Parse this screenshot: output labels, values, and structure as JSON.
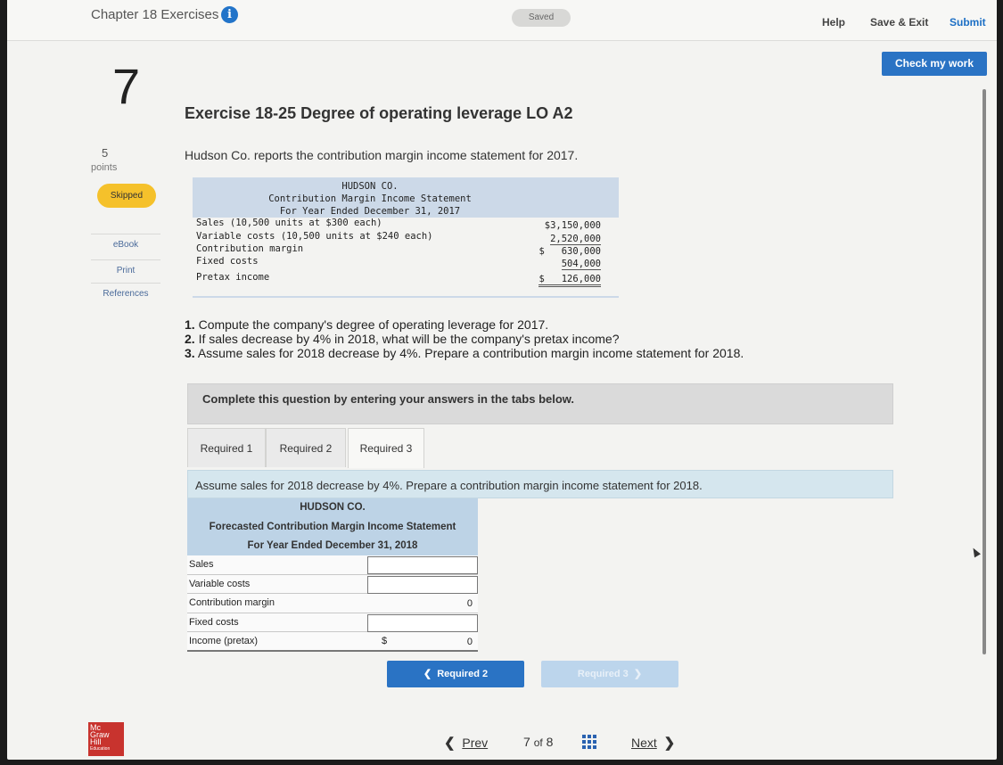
{
  "topbar": {
    "chapter_title": "Chapter 18 Exercises",
    "info_icon": "i",
    "saved_status": "Saved",
    "help": "Help",
    "save_exit": "Save & Exit",
    "submit": "Submit"
  },
  "check_my_work": "Check my work",
  "question": {
    "number": "7",
    "points_value": "5",
    "points_label": "points",
    "status_badge": "Skipped"
  },
  "sidebar": {
    "items": [
      {
        "label": "eBook"
      },
      {
        "label": "Print"
      },
      {
        "label": "References"
      }
    ]
  },
  "exercise": {
    "title": "Exercise 18-25 Degree of operating leverage LO A2",
    "intro": "Hudson Co. reports the contribution margin income statement for 2017."
  },
  "statement": {
    "company": "HUDSON CO.",
    "name": "Contribution Margin Income Statement",
    "period": "For Year Ended December 31, 2017",
    "rows": [
      {
        "label": "Sales (10,500 units at $300 each)",
        "amount": "$3,150,000"
      },
      {
        "label": "Variable costs (10,500 units at $240 each)",
        "amount": "2,520,000"
      },
      {
        "label": "Contribution margin",
        "amount": "$   630,000"
      },
      {
        "label": "Fixed costs",
        "amount": "504,000"
      },
      {
        "label": "Pretax income",
        "amount": "$   126,000"
      }
    ]
  },
  "questions": [
    {
      "num": "1.",
      "text": "Compute the company's degree of operating leverage for 2017."
    },
    {
      "num": "2.",
      "text": "If sales decrease by 4% in 2018, what will be the company's pretax income?"
    },
    {
      "num": "3.",
      "text": "Assume sales for 2018 decrease by 4%. Prepare a contribution margin income statement for 2018."
    }
  ],
  "instructions": "Complete this question by entering your answers in the tabs below.",
  "tabs": [
    {
      "label": "Required 1"
    },
    {
      "label": "Required 2"
    },
    {
      "label": "Required 3"
    }
  ],
  "prompt": "Assume sales for 2018 decrease by 4%. Prepare a contribution margin income statement for 2018.",
  "form": {
    "company": "HUDSON CO.",
    "name": "Forecasted Contribution Margin Income Statement",
    "period": "For Year Ended December 31, 2018",
    "rows": [
      {
        "label": "Sales",
        "value": ""
      },
      {
        "label": "Variable costs",
        "value": ""
      },
      {
        "label": "Contribution margin",
        "value": "0"
      },
      {
        "label": "Fixed costs",
        "value": ""
      },
      {
        "label": "Income (pretax)",
        "dollar": "$",
        "value": "0"
      }
    ]
  },
  "nav": {
    "prev_required": "Required 2",
    "next_required": "Required 3"
  },
  "logo": {
    "line1": "Mc",
    "line2": "Graw",
    "line3": "Hill",
    "line4": "Education"
  },
  "footer": {
    "prev": "Prev",
    "page_current": "7",
    "page_of": "of",
    "page_total": "8",
    "next": "Next"
  },
  "colors": {
    "accent_blue": "#2a73c4",
    "skipped_yellow": "#f5c12b",
    "header_blue": "#bdd3e6"
  }
}
